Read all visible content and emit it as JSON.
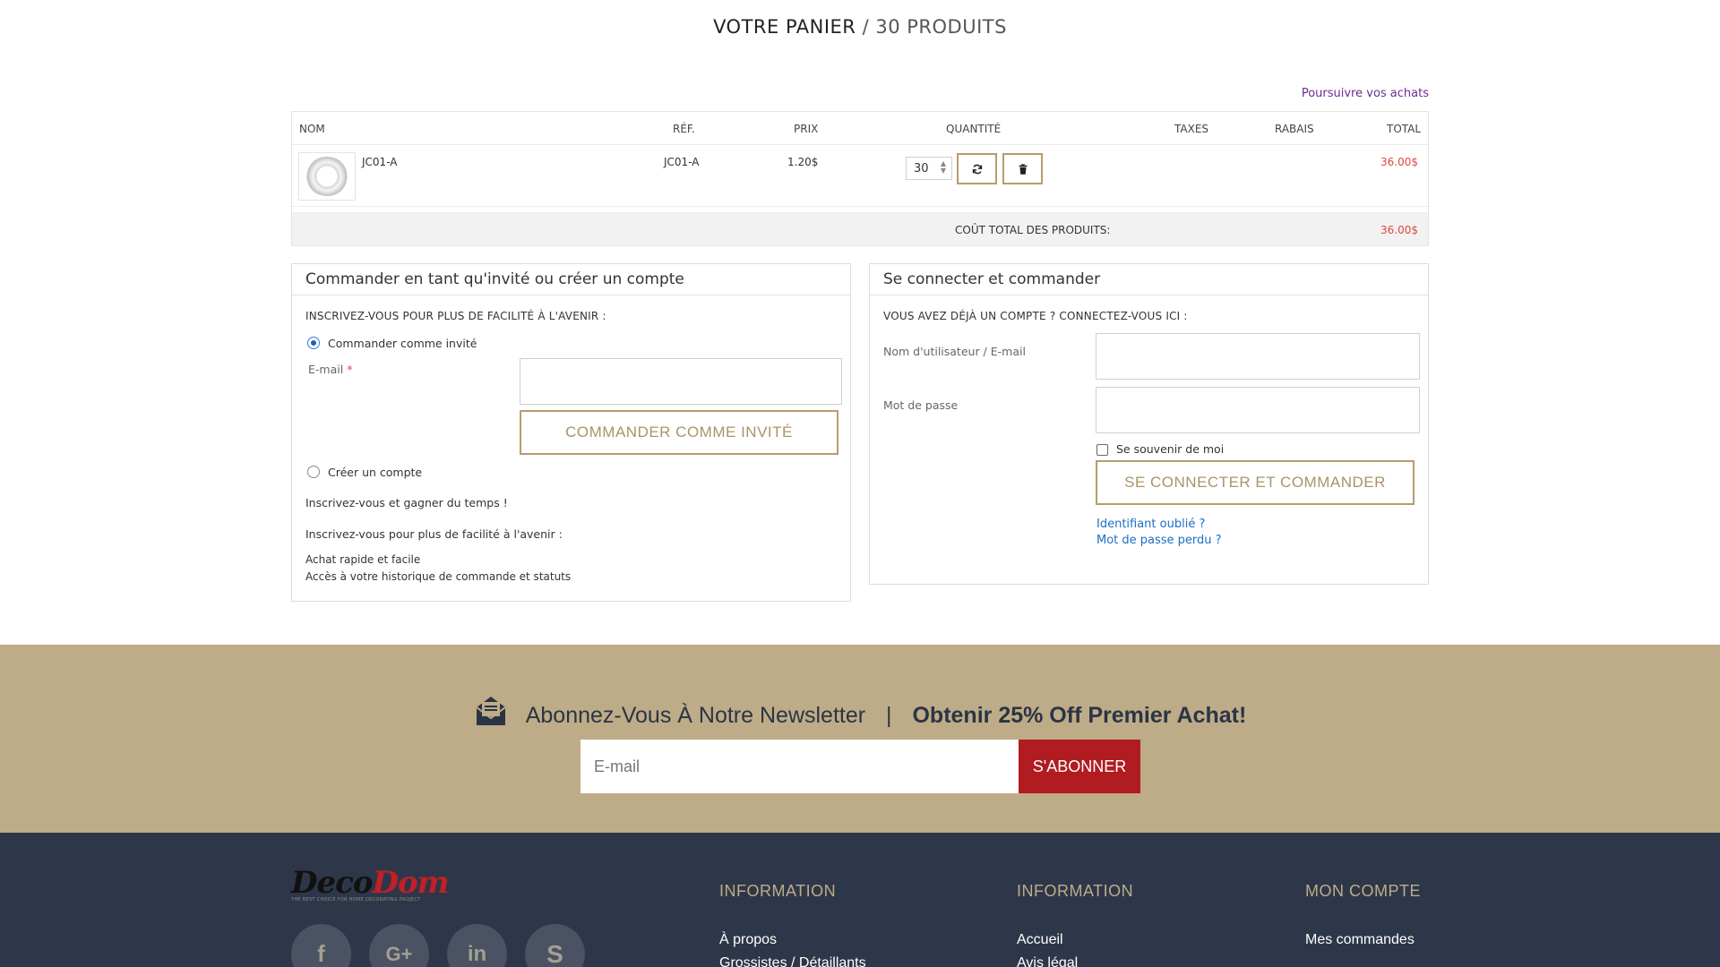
{
  "header": {
    "title_main": "VOTRE PANIER",
    "title_sub": "/ 30 PRODUITS",
    "continue_link": "Poursuivre vos achats"
  },
  "cart": {
    "columns": {
      "name": "NOM",
      "ref": "RÉF.",
      "price": "PRIX",
      "quantity": "QUANTITÉ",
      "taxes": "TAXES",
      "discount": "RABAIS",
      "total": "TOTAL"
    },
    "items": [
      {
        "name": "JC01-A",
        "ref": "JC01-A",
        "price": "1.20$",
        "quantity": "30",
        "total": "36.00$"
      }
    ],
    "total_label": "COÛT TOTAL DES PRODUITS:",
    "total_value": "36.00$"
  },
  "guest_panel": {
    "title": "Commander en tant qu'invité ou créer un compte",
    "intro": "INSCRIVEZ-VOUS POUR PLUS DE FACILITÉ À L'AVENIR :",
    "option_guest": "Commander comme invité",
    "email_label": "E-mail",
    "required_mark": "*",
    "guest_button": "COMMANDER COMME INVITÉ",
    "option_create": "Créer un compte",
    "benefit_line1": "Inscrivez-vous et gagner du temps !",
    "benefit_line2": "Inscrivez-vous pour plus de facilité à l'avenir :",
    "benefit_item1": "Achat rapide et facile",
    "benefit_item2": "Accès à votre historique de commande et statuts"
  },
  "login_panel": {
    "title": "Se connecter et commander",
    "intro": "VOUS AVEZ DÉJÀ UN COMPTE ? CONNECTEZ-VOUS ICI :",
    "username_label": "Nom d'utilisateur / E-mail",
    "password_label": "Mot de passe",
    "remember_label": "Se souvenir de moi",
    "login_button": "SE CONNECTER ET COMMANDER",
    "forgot_username": "Identifiant oublié ?",
    "forgot_password": "Mot de passe perdu ?"
  },
  "newsletter": {
    "headline": "Abonnez-Vous À Notre Newsletter",
    "separator": "|",
    "offer": "Obtenir 25% Off Premier Achat!",
    "email_placeholder": "E-mail",
    "subscribe_button": "S'ABONNER"
  },
  "footer": {
    "logo_part1": "Deco",
    "logo_part2": "Dom",
    "logo_tagline": "THE BEST CHOICE FOR HOME DECORATING PROJECT",
    "col1_title": "INFORMATION",
    "col1_links": [
      "À propos",
      "Grossistes / Détaillants"
    ],
    "col2_title": "INFORMATION",
    "col2_links": [
      "Accueil",
      "Avis légal"
    ],
    "col3_title": "MON COMPTE",
    "col3_links": [
      "Mes commandes"
    ],
    "social_icons": [
      "facebook-icon",
      "google-plus-icon",
      "linkedin-icon",
      "skype-icon"
    ]
  },
  "colors": {
    "accent_gold": "#b69c6e",
    "price_red": "#e0483e",
    "subscribe_red": "#b01c20",
    "footer_navy": "#2e3749",
    "newsletter_bg": "#bdac87"
  }
}
